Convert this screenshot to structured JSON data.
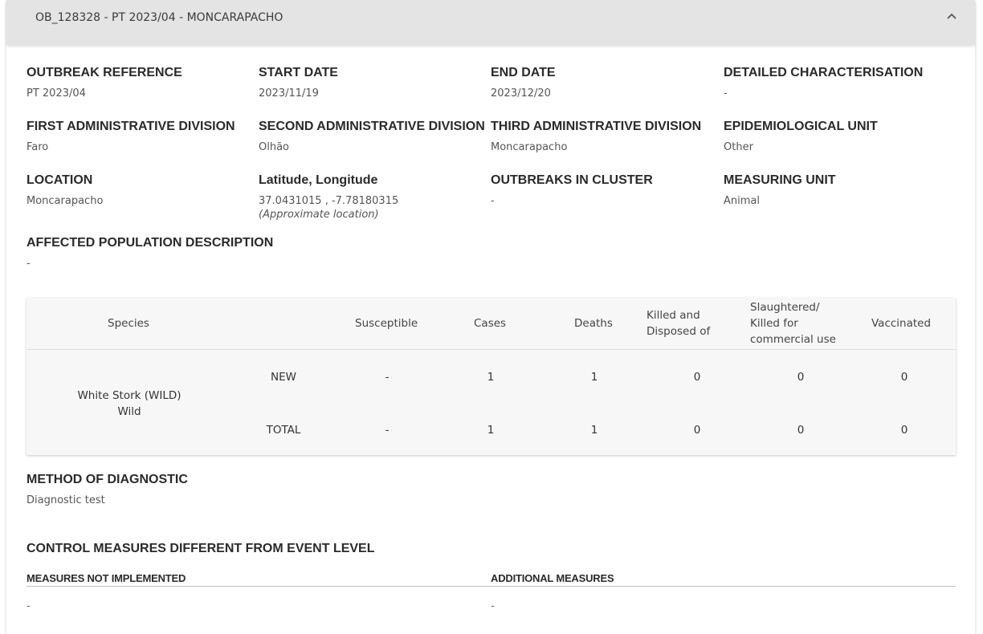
{
  "header": {
    "title": "OB_128328 - PT 2023/04 - MONCARAPACHO"
  },
  "fields": {
    "outbreak_reference": {
      "label": "OUTBREAK REFERENCE",
      "value": "PT 2023/04"
    },
    "start_date": {
      "label": "START DATE",
      "value": "2023/11/19"
    },
    "end_date": {
      "label": "END DATE",
      "value": "2023/12/20"
    },
    "detailed_characterisation": {
      "label": "DETAILED CHARACTERISATION",
      "value": "-"
    },
    "first_admin": {
      "label": "FIRST ADMINISTRATIVE DIVISION",
      "value": "Faro"
    },
    "second_admin": {
      "label": "SECOND ADMINISTRATIVE DIVISION",
      "value": "Olhão"
    },
    "third_admin": {
      "label": "THIRD ADMINISTRATIVE DIVISION",
      "value": "Moncarapacho"
    },
    "epi_unit": {
      "label": "EPIDEMIOLOGICAL UNIT",
      "value": "Other"
    },
    "location": {
      "label": "LOCATION",
      "value": "Moncarapacho"
    },
    "latlon": {
      "label": "Latitude, Longitude",
      "value": "37.0431015 , -7.78180315",
      "note": "(Approximate location)"
    },
    "outbreaks_in_cluster": {
      "label": "OUTBREAKS IN CLUSTER",
      "value": "-"
    },
    "measuring_unit": {
      "label": "MEASURING UNIT",
      "value": "Animal"
    },
    "affected_population": {
      "label": "AFFECTED POPULATION DESCRIPTION",
      "value": "-"
    }
  },
  "table": {
    "headers": {
      "species": "Species",
      "susceptible": "Susceptible",
      "cases": "Cases",
      "deaths": "Deaths",
      "killed_1": "Killed and",
      "killed_2": "Disposed of",
      "slaughtered_1": "Slaughtered/",
      "slaughtered_2": "Killed for",
      "slaughtered_3": "commercial use",
      "vaccinated": "Vaccinated"
    },
    "species_name": "White Stork (WILD)",
    "species_type": "Wild",
    "rows": [
      {
        "label": "NEW",
        "susceptible": "-",
        "cases": "1",
        "deaths": "1",
        "killed": "0",
        "slaughtered": "0",
        "vaccinated": "0"
      },
      {
        "label": "TOTAL",
        "susceptible": "-",
        "cases": "1",
        "deaths": "1",
        "killed": "0",
        "slaughtered": "0",
        "vaccinated": "0"
      }
    ]
  },
  "diagnostic": {
    "label": "METHOD OF DIAGNOSTIC",
    "value": "Diagnostic test"
  },
  "control": {
    "title": "CONTROL MEASURES DIFFERENT FROM EVENT LEVEL",
    "not_implemented_label": "MEASURES NOT IMPLEMENTED",
    "not_implemented_value": "-",
    "additional_label": "ADDITIONAL MEASURES",
    "additional_value": "-"
  },
  "icons": {
    "collapse": "chevron-up-icon"
  }
}
